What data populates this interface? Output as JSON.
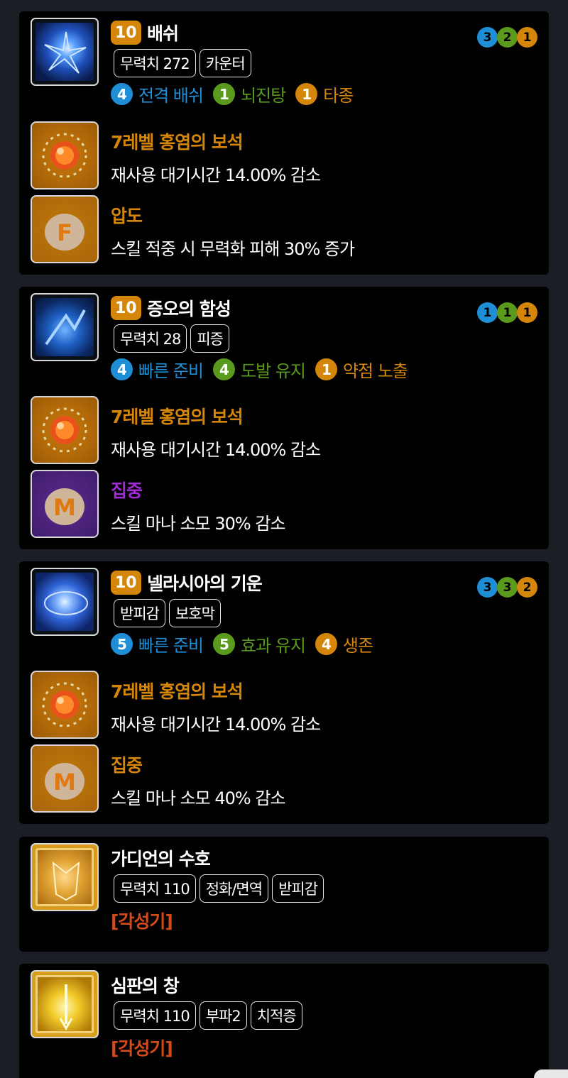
{
  "colors": {
    "blue": "#1e8fd6",
    "green": "#5a9a1c",
    "orange": "#d4860a",
    "purple": "#a22bd6",
    "awaken": "#d44b1a"
  },
  "cards": [
    {
      "level": "10",
      "name": "배쉬",
      "tags": [
        "무력치 272",
        "카운터"
      ],
      "tripods": [
        {
          "num": "4",
          "label": "전격 배쉬",
          "color": "blue"
        },
        {
          "num": "1",
          "label": "뇌진탕",
          "color": "green"
        },
        {
          "num": "1",
          "label": "타종",
          "color": "orange"
        }
      ],
      "dots": [
        "3",
        "2",
        "1"
      ],
      "gem": {
        "title": "7레벨 홍염의 보석",
        "desc": "재사용 대기시간 14.00% 감소"
      },
      "rune": {
        "title": "압도",
        "desc": "스킬 적중 시 무력화 피해 30% 증가",
        "color": "orange",
        "glyph": "F"
      }
    },
    {
      "level": "10",
      "name": "증오의 함성",
      "tags": [
        "무력치 28",
        "피증"
      ],
      "tripods": [
        {
          "num": "4",
          "label": "빠른 준비",
          "color": "blue"
        },
        {
          "num": "4",
          "label": "도발 유지",
          "color": "green"
        },
        {
          "num": "1",
          "label": "약점 노출",
          "color": "orange"
        }
      ],
      "dots": [
        "1",
        "1",
        "1"
      ],
      "gem": {
        "title": "7레벨 홍염의 보석",
        "desc": "재사용 대기시간 14.00% 감소"
      },
      "rune": {
        "title": "집중",
        "desc": "스킬 마나 소모 30% 감소",
        "color": "purple",
        "glyph": "M"
      }
    },
    {
      "level": "10",
      "name": "넬라시아의 기운",
      "tags": [
        "받피감",
        "보호막"
      ],
      "tripods": [
        {
          "num": "5",
          "label": "빠른 준비",
          "color": "blue"
        },
        {
          "num": "5",
          "label": "효과 유지",
          "color": "green"
        },
        {
          "num": "4",
          "label": "생존",
          "color": "orange"
        }
      ],
      "dots": [
        "3",
        "3",
        "2"
      ],
      "gem": {
        "title": "7레벨 홍염의 보석",
        "desc": "재사용 대기시간 14.00% 감소"
      },
      "rune": {
        "title": "집중",
        "desc": "스킬 마나 소모 40% 감소",
        "color": "orange",
        "glyph": "M"
      }
    },
    {
      "name": "가디언의 수호",
      "tags": [
        "무력치 110",
        "정화/면역",
        "받피감"
      ],
      "awaken": "[각성기]"
    },
    {
      "name": "심판의 창",
      "tags": [
        "무력치 110",
        "부파2",
        "치적증"
      ],
      "awaken": "[각성기]"
    }
  ]
}
